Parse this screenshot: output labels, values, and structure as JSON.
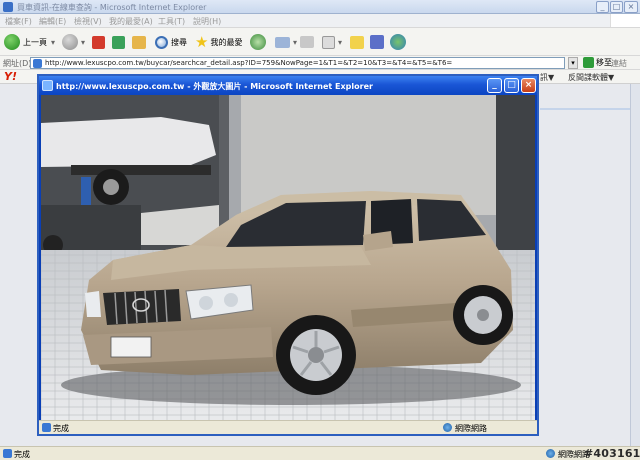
{
  "outer_window": {
    "title": "買車資訊-在線車查詢 - Microsoft Internet Explorer",
    "menu": [
      "檔案(F)",
      "編輯(E)",
      "檢視(V)",
      "我的最愛(A)",
      "工具(T)",
      "說明(H)"
    ],
    "toolbar": {
      "back": "上一頁",
      "search": "搜尋",
      "favorites": "我的最愛"
    },
    "address_label": "網址(D)",
    "address_value": "http://www.lexuscpo.com.tw/buycar/searchcar_detail.asp?ID=759&NowPage=1&T1=&T2=10&T3=&T4=&T5=&T6=",
    "go_label": "移至",
    "links_label": "連結",
    "links_right": [
      "訊▼",
      "反間諜軟體▼"
    ],
    "status_text": "完成",
    "zone_text": "網際網路"
  },
  "popup": {
    "title": "http://www.lexuscpo.com.tw - 外觀放大圖片 - Microsoft Internet Explorer",
    "status_text": "完成",
    "zone_text": "網際網路"
  },
  "watermark": "#403161",
  "colors": {
    "popup_titlebar": "#1a56d6",
    "close_button": "#d4532c",
    "car_body": "#b8a68e"
  }
}
